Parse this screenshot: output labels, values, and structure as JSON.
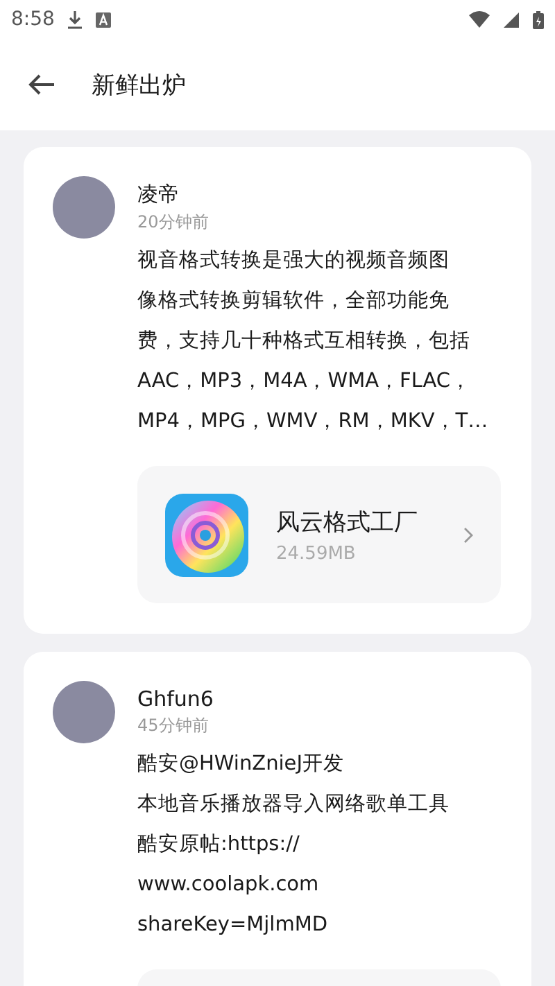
{
  "status_bar": {
    "time": "8:58"
  },
  "header": {
    "title": "新鲜出炉"
  },
  "posts": [
    {
      "author": "凌帝",
      "time": "20分钟前",
      "body_lines": [
        "视音格式转换是强大的视频音频图",
        "像格式转换剪辑软件，全部功能免",
        "费，支持几十种格式互相转换，包括",
        "AAC，MP3，M4A，WMA，FLAC，",
        "MP4，MPG，WMV，RM，MKV，T…"
      ],
      "app": {
        "name": "风云格式工厂",
        "size": "24.59MB"
      }
    },
    {
      "author": "Ghfun6",
      "time": "45分钟前",
      "body_lines": [
        "酷安@HWinZnieJ开发",
        "本地音乐播放器导入网络歌单工具",
        "酷安原帖:https://",
        "www.coolapk.com",
        "shareKey=MjlmMD"
      ],
      "app_visible": true
    }
  ]
}
